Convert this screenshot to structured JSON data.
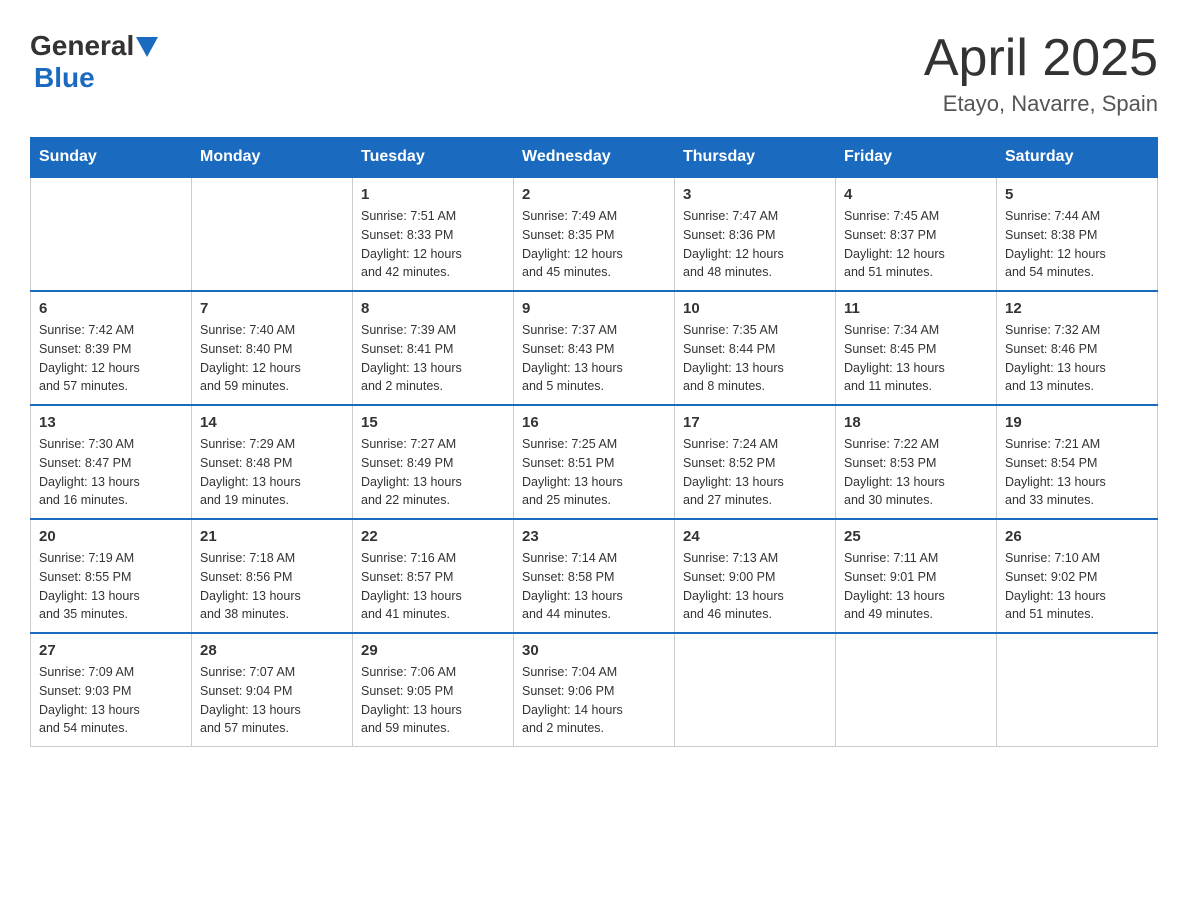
{
  "header": {
    "logo": {
      "general": "General",
      "blue": "Blue"
    },
    "title": "April 2025",
    "subtitle": "Etayo, Navarre, Spain"
  },
  "days_of_week": [
    "Sunday",
    "Monday",
    "Tuesday",
    "Wednesday",
    "Thursday",
    "Friday",
    "Saturday"
  ],
  "weeks": [
    [
      {
        "day": "",
        "info": ""
      },
      {
        "day": "",
        "info": ""
      },
      {
        "day": "1",
        "info": "Sunrise: 7:51 AM\nSunset: 8:33 PM\nDaylight: 12 hours\nand 42 minutes."
      },
      {
        "day": "2",
        "info": "Sunrise: 7:49 AM\nSunset: 8:35 PM\nDaylight: 12 hours\nand 45 minutes."
      },
      {
        "day": "3",
        "info": "Sunrise: 7:47 AM\nSunset: 8:36 PM\nDaylight: 12 hours\nand 48 minutes."
      },
      {
        "day": "4",
        "info": "Sunrise: 7:45 AM\nSunset: 8:37 PM\nDaylight: 12 hours\nand 51 minutes."
      },
      {
        "day": "5",
        "info": "Sunrise: 7:44 AM\nSunset: 8:38 PM\nDaylight: 12 hours\nand 54 minutes."
      }
    ],
    [
      {
        "day": "6",
        "info": "Sunrise: 7:42 AM\nSunset: 8:39 PM\nDaylight: 12 hours\nand 57 minutes."
      },
      {
        "day": "7",
        "info": "Sunrise: 7:40 AM\nSunset: 8:40 PM\nDaylight: 12 hours\nand 59 minutes."
      },
      {
        "day": "8",
        "info": "Sunrise: 7:39 AM\nSunset: 8:41 PM\nDaylight: 13 hours\nand 2 minutes."
      },
      {
        "day": "9",
        "info": "Sunrise: 7:37 AM\nSunset: 8:43 PM\nDaylight: 13 hours\nand 5 minutes."
      },
      {
        "day": "10",
        "info": "Sunrise: 7:35 AM\nSunset: 8:44 PM\nDaylight: 13 hours\nand 8 minutes."
      },
      {
        "day": "11",
        "info": "Sunrise: 7:34 AM\nSunset: 8:45 PM\nDaylight: 13 hours\nand 11 minutes."
      },
      {
        "day": "12",
        "info": "Sunrise: 7:32 AM\nSunset: 8:46 PM\nDaylight: 13 hours\nand 13 minutes."
      }
    ],
    [
      {
        "day": "13",
        "info": "Sunrise: 7:30 AM\nSunset: 8:47 PM\nDaylight: 13 hours\nand 16 minutes."
      },
      {
        "day": "14",
        "info": "Sunrise: 7:29 AM\nSunset: 8:48 PM\nDaylight: 13 hours\nand 19 minutes."
      },
      {
        "day": "15",
        "info": "Sunrise: 7:27 AM\nSunset: 8:49 PM\nDaylight: 13 hours\nand 22 minutes."
      },
      {
        "day": "16",
        "info": "Sunrise: 7:25 AM\nSunset: 8:51 PM\nDaylight: 13 hours\nand 25 minutes."
      },
      {
        "day": "17",
        "info": "Sunrise: 7:24 AM\nSunset: 8:52 PM\nDaylight: 13 hours\nand 27 minutes."
      },
      {
        "day": "18",
        "info": "Sunrise: 7:22 AM\nSunset: 8:53 PM\nDaylight: 13 hours\nand 30 minutes."
      },
      {
        "day": "19",
        "info": "Sunrise: 7:21 AM\nSunset: 8:54 PM\nDaylight: 13 hours\nand 33 minutes."
      }
    ],
    [
      {
        "day": "20",
        "info": "Sunrise: 7:19 AM\nSunset: 8:55 PM\nDaylight: 13 hours\nand 35 minutes."
      },
      {
        "day": "21",
        "info": "Sunrise: 7:18 AM\nSunset: 8:56 PM\nDaylight: 13 hours\nand 38 minutes."
      },
      {
        "day": "22",
        "info": "Sunrise: 7:16 AM\nSunset: 8:57 PM\nDaylight: 13 hours\nand 41 minutes."
      },
      {
        "day": "23",
        "info": "Sunrise: 7:14 AM\nSunset: 8:58 PM\nDaylight: 13 hours\nand 44 minutes."
      },
      {
        "day": "24",
        "info": "Sunrise: 7:13 AM\nSunset: 9:00 PM\nDaylight: 13 hours\nand 46 minutes."
      },
      {
        "day": "25",
        "info": "Sunrise: 7:11 AM\nSunset: 9:01 PM\nDaylight: 13 hours\nand 49 minutes."
      },
      {
        "day": "26",
        "info": "Sunrise: 7:10 AM\nSunset: 9:02 PM\nDaylight: 13 hours\nand 51 minutes."
      }
    ],
    [
      {
        "day": "27",
        "info": "Sunrise: 7:09 AM\nSunset: 9:03 PM\nDaylight: 13 hours\nand 54 minutes."
      },
      {
        "day": "28",
        "info": "Sunrise: 7:07 AM\nSunset: 9:04 PM\nDaylight: 13 hours\nand 57 minutes."
      },
      {
        "day": "29",
        "info": "Sunrise: 7:06 AM\nSunset: 9:05 PM\nDaylight: 13 hours\nand 59 minutes."
      },
      {
        "day": "30",
        "info": "Sunrise: 7:04 AM\nSunset: 9:06 PM\nDaylight: 14 hours\nand 2 minutes."
      },
      {
        "day": "",
        "info": ""
      },
      {
        "day": "",
        "info": ""
      },
      {
        "day": "",
        "info": ""
      }
    ]
  ]
}
